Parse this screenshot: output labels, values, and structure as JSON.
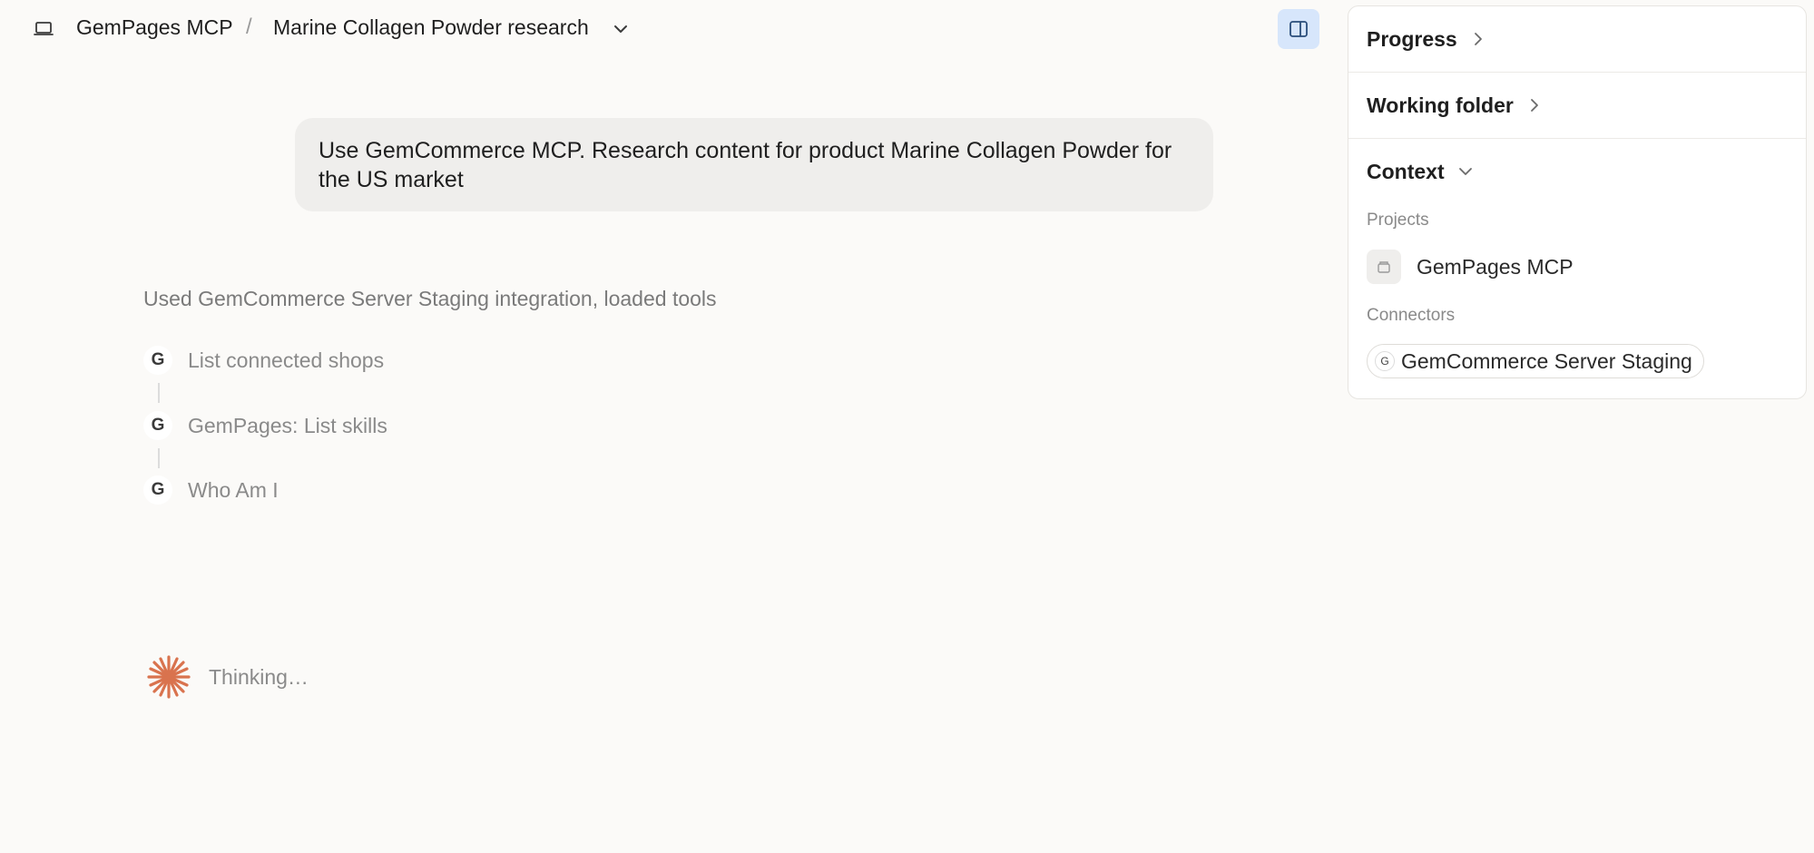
{
  "header": {
    "project_name": "GemPages MCP",
    "separator": "/",
    "chat_title": "Marine Collagen Powder research",
    "laptop_icon": "laptop-icon",
    "chevron_icon": "chevron-down-icon",
    "panel_toggle_icon": "sidebar-panel-icon",
    "panel_toggle_color": "#d7e6fb"
  },
  "conversation": {
    "user_message": "Use GemCommerce MCP. Research content for product Marine Collagen Powder for the US market",
    "tools_summary": "Used GemCommerce Server Staging integration, loaded tools",
    "tool_calls": [
      {
        "badge": "G",
        "label": "List connected shops"
      },
      {
        "badge": "G",
        "label": "GemPages: List skills"
      },
      {
        "badge": "G",
        "label": "Who Am I"
      }
    ],
    "status": {
      "icon": "spark-icon",
      "text": "Thinking…",
      "color": "#d9734e"
    }
  },
  "side_panel": {
    "progress": {
      "title": "Progress",
      "icon": "chevron-right-icon"
    },
    "working_folder": {
      "title": "Working folder",
      "icon": "chevron-right-icon"
    },
    "context": {
      "title": "Context",
      "icon": "chevron-down-icon",
      "projects_label": "Projects",
      "project": {
        "name": "GemPages MCP",
        "icon": "folder-icon"
      },
      "connectors_label": "Connectors",
      "connector": {
        "badge": "G",
        "name": "GemCommerce Server Staging"
      }
    }
  }
}
